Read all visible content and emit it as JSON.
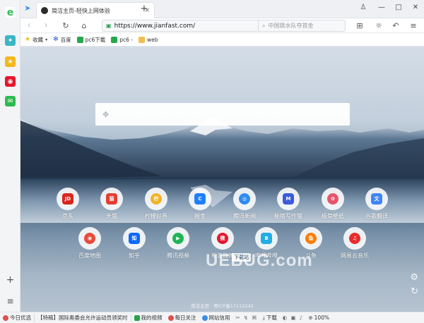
{
  "sidebar": {
    "items": [
      "browser-logo",
      "compass",
      "favorites",
      "weibo",
      "mail"
    ],
    "add": "+",
    "menu": "≡"
  },
  "tab": {
    "title": "简洁主页-轻快上网体验",
    "close": "×",
    "new_tab": "+"
  },
  "window_controls": {
    "shirt": "ༀ",
    "minimize": "—",
    "maximize": "□",
    "close": "✕"
  },
  "nav": {
    "back": "‹",
    "forward": "›",
    "reload": "↻",
    "home": "⌂",
    "url": "https://www.jianfast.com/",
    "search_placeholder": "中国跳水队夺首金"
  },
  "bookmarks": [
    {
      "label": "收藏",
      "icon": "star-icon",
      "color": "#f5b81c"
    },
    {
      "label": "百度",
      "icon": "baidu-icon",
      "color": "#2b5fd6"
    },
    {
      "label": "pc6下载",
      "icon": "pc6-icon",
      "color": "#23a94a"
    },
    {
      "label": "pc6 -",
      "icon": "pc6-icon",
      "color": "#23a94a"
    },
    {
      "label": "web",
      "icon": "folder-icon",
      "color": "#f0c14b"
    }
  ],
  "apps_row1": [
    {
      "label": "京东",
      "icon": "jd-icon",
      "color": "#d9261c",
      "glyph": "JD"
    },
    {
      "label": "天猫",
      "icon": "tmall-icon",
      "color": "#e33f2f",
      "glyph": "猫"
    },
    {
      "label": "柠檬好券",
      "icon": "lemon-icon",
      "color": "#f0b323",
      "glyph": "柠"
    },
    {
      "label": "掘金",
      "icon": "juejin-icon",
      "color": "#1e80ff",
      "glyph": "C"
    },
    {
      "label": "腾讯新闻",
      "icon": "tencent-news-icon",
      "color": "#2e8cf0",
      "glyph": "◎"
    },
    {
      "label": "秘塔写作猫",
      "icon": "mita-icon",
      "color": "#3b5bdb",
      "glyph": "M"
    },
    {
      "label": "极简壁纸",
      "icon": "wallpaper-icon",
      "color": "#e8546b",
      "glyph": "✿"
    },
    {
      "label": "谷歌翻译",
      "icon": "google-translate-icon",
      "color": "#4285f4",
      "glyph": "文"
    }
  ],
  "apps_row2": [
    {
      "label": "百度地图",
      "icon": "baidu-map-icon",
      "color": "#e84c3d",
      "glyph": "◉"
    },
    {
      "label": "知乎",
      "icon": "zhihu-icon",
      "color": "#0a66ff",
      "glyph": "知"
    },
    {
      "label": "腾讯视频",
      "icon": "tencent-video-icon",
      "color": "#1fb557",
      "glyph": "▶"
    },
    {
      "label": "新浪微博",
      "icon": "weibo-icon",
      "color": "#e6162d",
      "glyph": "微"
    },
    {
      "label": "哔哩哔哩",
      "icon": "bilibili-icon",
      "color": "#23ade5",
      "glyph": "B"
    },
    {
      "label": "斗鱼",
      "icon": "douyu-icon",
      "color": "#ff7d00",
      "glyph": "鱼"
    },
    {
      "label": "网易云音乐",
      "icon": "netease-music-icon",
      "color": "#e72d2c",
      "glyph": "♫"
    }
  ],
  "watermark": {
    "text": "UEBUG.com",
    "sub": "下载站"
  },
  "footer": "简洁主页 · 粤ICP备17112242",
  "statusbar": {
    "items": [
      "今日优选",
      "【特稿】国际奥委会允许运动员领奖时",
      "我的视频",
      "每日关注",
      "网站信用",
      "下载",
      "100%"
    ]
  }
}
